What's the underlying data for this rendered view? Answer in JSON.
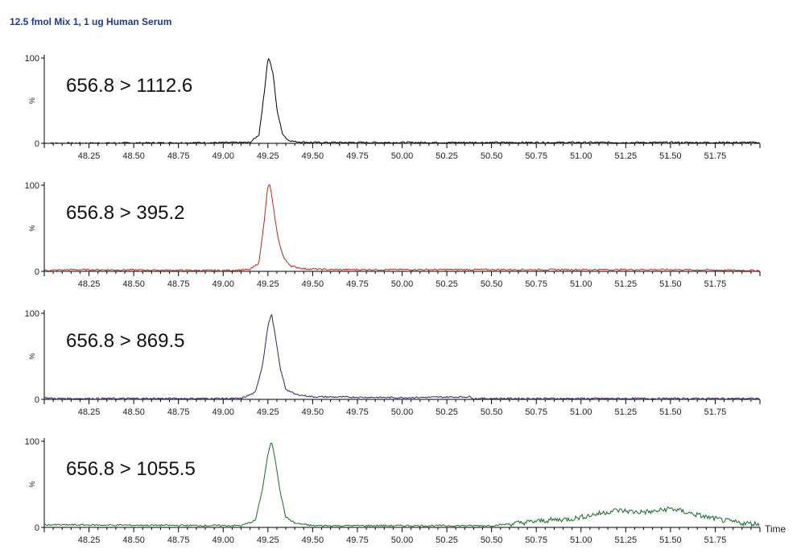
{
  "title": "12.5 fmol Mix 1, 1 ug Human Serum",
  "chart_data": {
    "type": "line",
    "title": "12.5 fmol Mix 1, 1 ug Human Serum",
    "xlabel": "Time",
    "ylabel": "%",
    "xlim": [
      48.0,
      52.0
    ],
    "ylim": [
      0,
      100
    ],
    "x_ticks": [
      "48.25",
      "48.50",
      "48.75",
      "49.00",
      "49.25",
      "49.50",
      "49.75",
      "50.00",
      "50.25",
      "50.50",
      "50.75",
      "51.00",
      "51.25",
      "51.50",
      "51.75"
    ],
    "y_ticks": [
      "0",
      "100"
    ],
    "grid": false,
    "panels": [
      {
        "name": "656.8 > 1112.6",
        "color": "#000000",
        "x": [
          48.0,
          49.15,
          49.2,
          49.23,
          49.25,
          49.26,
          49.28,
          49.3,
          49.33,
          49.36,
          49.4,
          49.5,
          50.0,
          51.0,
          52.0
        ],
        "y": [
          0,
          1,
          10,
          60,
          100,
          97,
          80,
          40,
          12,
          4,
          2,
          1,
          1,
          1,
          1
        ]
      },
      {
        "name": "656.8 > 395.2",
        "color": "#c0261c",
        "x": [
          48.0,
          48.15,
          49.0,
          49.15,
          49.2,
          49.23,
          49.25,
          49.26,
          49.27,
          49.29,
          49.31,
          49.34,
          49.38,
          49.45,
          49.6,
          50.0,
          51.0,
          51.5,
          52.0
        ],
        "y": [
          1,
          2,
          1,
          2,
          10,
          60,
          100,
          100,
          90,
          60,
          35,
          15,
          6,
          3,
          2,
          2,
          2,
          2,
          1
        ],
        "smooth_points": false
      },
      {
        "name": "656.8 > 869.5",
        "color": "#3a1d6e",
        "x": [
          48.0,
          48.05,
          49.0,
          49.1,
          49.18,
          49.22,
          49.25,
          49.27,
          49.29,
          49.32,
          49.35,
          49.4,
          49.5,
          50.0,
          50.38,
          50.4,
          51.0,
          52.0
        ],
        "y": [
          2,
          1,
          1,
          1,
          8,
          40,
          85,
          100,
          75,
          35,
          12,
          6,
          3,
          2,
          3,
          1,
          1,
          1
        ]
      },
      {
        "name": "656.8 > 1055.5",
        "color": "#1d6b2a",
        "x": [
          48.0,
          49.1,
          49.18,
          49.22,
          49.25,
          49.27,
          49.29,
          49.32,
          49.35,
          49.4,
          49.5,
          50.0,
          50.5,
          50.65,
          50.8,
          50.95,
          51.1,
          51.2,
          51.3,
          51.4,
          51.5,
          51.6,
          51.7,
          51.8,
          51.9,
          52.0
        ],
        "y": [
          3,
          2,
          8,
          45,
          85,
          100,
          80,
          40,
          12,
          5,
          2,
          2,
          2,
          5,
          8,
          10,
          16,
          20,
          18,
          18,
          22,
          17,
          12,
          8,
          5,
          4
        ]
      }
    ]
  }
}
